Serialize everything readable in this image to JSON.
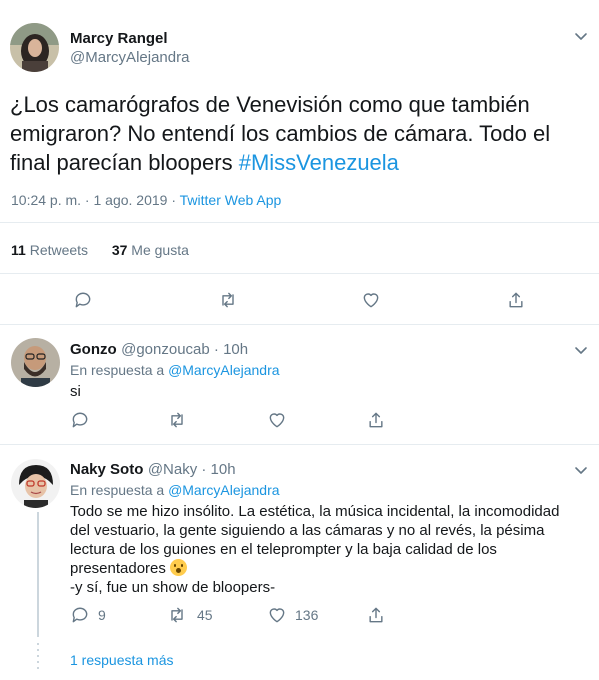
{
  "main_tweet": {
    "author_name": "Marcy Rangel",
    "author_handle": "@MarcyAlejandra",
    "text": "¿Los camarógrafos de Venevisión como que también emigraron? No entendí los cambios de cámara. Todo el final parecían bloopers ",
    "hashtag": "#MissVenezuela",
    "time": "10:24 p. m. · 1 ago. 2019 · ",
    "source": "Twitter Web App",
    "retweets_count": "11",
    "retweets_label": " Retweets",
    "likes_count": "37",
    "likes_label": " Me gusta"
  },
  "replies": [
    {
      "author_name": "Gonzo",
      "author_handle": "@gonzoucab",
      "time": " · 10h",
      "reply_prefix": "En respuesta a ",
      "reply_to": "@MarcyAlejandra",
      "text": "si"
    },
    {
      "author_name": "Naky Soto",
      "author_handle": "@Naky",
      "time": " · 10h",
      "reply_prefix": "En respuesta a ",
      "reply_to": "@MarcyAlejandra",
      "text": "Todo se me hizo insólito. La estética, la música incidental, la incomodidad del vestuario, la gente siguiendo a las cámaras y no al revés, la pésima lectura de los guiones en el teleprompter y la baja calidad de los presentadores ",
      "text2": "-y sí, fue un show de bloopers-",
      "reply_count": "9",
      "retweet_count": "45",
      "like_count": "136"
    }
  ],
  "more_replies": "1 respuesta más",
  "colors": {
    "accent": "#1b95e0",
    "muted": "#657786",
    "divider": "#e6ecf0"
  }
}
